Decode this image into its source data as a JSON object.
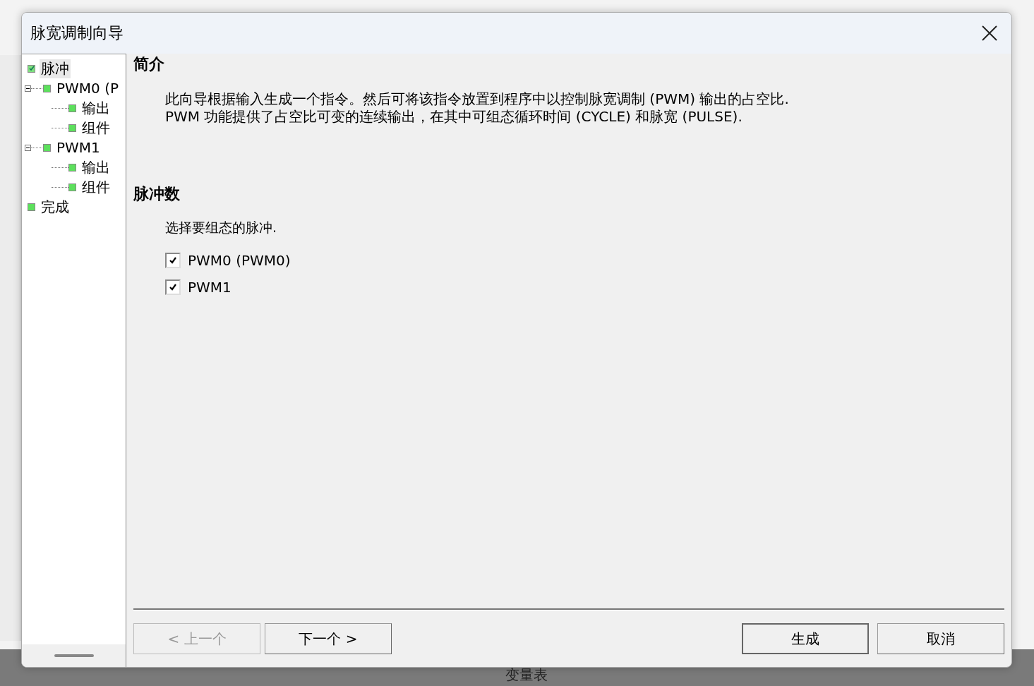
{
  "window": {
    "title": "脉宽调制向导"
  },
  "tree": [
    {
      "label": "脉冲",
      "selected": true,
      "checked": true
    },
    {
      "label": "PWM0 (P",
      "selected": false,
      "checked": false,
      "expanded": true,
      "children": [
        {
          "label": "输出",
          "selected": false,
          "checked": false
        },
        {
          "label": "组件",
          "selected": false,
          "checked": false
        }
      ]
    },
    {
      "label": "PWM1",
      "selected": false,
      "checked": false,
      "expanded": true,
      "children": [
        {
          "label": "输出",
          "selected": false,
          "checked": false
        },
        {
          "label": "组件",
          "selected": false,
          "checked": false
        }
      ]
    },
    {
      "label": "完成",
      "selected": false,
      "checked": false
    }
  ],
  "intro": {
    "heading": "简介",
    "text": "此向导根据输入生成一个指令。然后可将该指令放置到程序中以控制脉宽调制 (PWM) 输出的占空比. PWM 功能提供了占空比可变的连续输出，在其中可组态循环时间 (CYCLE) 和脉宽 (PULSE)."
  },
  "pulses": {
    "heading": "脉冲数",
    "prompt": "选择要组态的脉冲.",
    "options": [
      {
        "label": "PWM0 (PWM0)",
        "checked": true
      },
      {
        "label": "PWM1",
        "checked": true
      }
    ]
  },
  "nav_buttons": [
    {
      "label": "< 上一个",
      "disabled": true
    },
    {
      "label": "下一个 >",
      "disabled": false
    }
  ],
  "action_buttons": [
    {
      "label": "生成",
      "default": true
    },
    {
      "label": "取消",
      "default": false
    }
  ],
  "background": {
    "status_text": "变量表"
  }
}
